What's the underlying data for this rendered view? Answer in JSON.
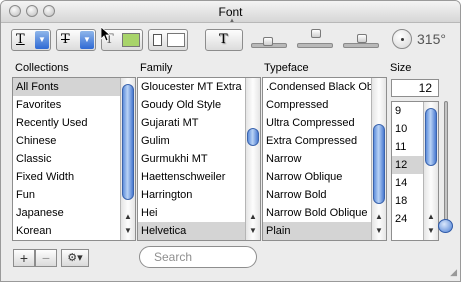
{
  "window": {
    "title": "Font"
  },
  "toolbar": {
    "underline_glyph": "T",
    "strike_glyph": "T",
    "color_glyph": "T",
    "shadow_glyph": "T",
    "angle_value": "315°",
    "text_color": "#a8d46a",
    "doc_color": "#ffffff"
  },
  "headers": {
    "collections": "Collections",
    "family": "Family",
    "typeface": "Typeface",
    "size": "Size"
  },
  "collections": [
    "All Fonts",
    "Favorites",
    "Recently Used",
    "Chinese",
    "Classic",
    "Fixed Width",
    "Fun",
    "Japanese",
    "Korean"
  ],
  "family": [
    "Gloucester MT Extra",
    "Goudy Old Style",
    "Gujarati MT",
    "Gulim",
    "Gurmukhi MT",
    "Haettenschweiler",
    "Harrington",
    "Hei",
    "Helvetica"
  ],
  "typeface": [
    ".Condensed Black Oblique",
    "Compressed",
    "Ultra Compressed",
    "Extra Compressed",
    "Narrow",
    "Narrow Oblique",
    "Narrow Bold",
    "Narrow Bold Oblique",
    "Plain"
  ],
  "size": {
    "value": "12",
    "options": [
      "9",
      "10",
      "11",
      "12",
      "14",
      "18",
      "24"
    ]
  },
  "bottom": {
    "add": "+",
    "remove": "−",
    "action": "⚙▾",
    "search_placeholder": "Search"
  }
}
